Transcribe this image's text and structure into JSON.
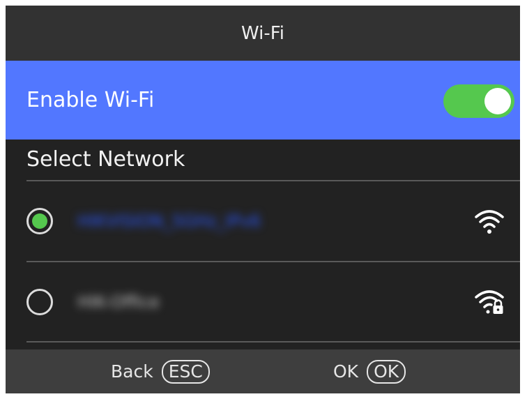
{
  "header": {
    "title": "Wi-Fi"
  },
  "wifi_toggle": {
    "label": "Enable Wi-Fi",
    "on": true,
    "accent": "#55c84e",
    "row_color": "#5277ff"
  },
  "networks_section": {
    "title": "Select Network"
  },
  "networks": [
    {
      "ssid": "HIKVISION_5GHz_IPv6",
      "selected": true,
      "secured": false,
      "icon": "wifi-signal-icon"
    },
    {
      "ssid": "HIK-Office",
      "selected": false,
      "secured": true,
      "icon": "wifi-lock-icon"
    }
  ],
  "footer": {
    "back_label": "Back",
    "back_key": "ESC",
    "ok_label": "OK",
    "ok_key": "OK"
  }
}
